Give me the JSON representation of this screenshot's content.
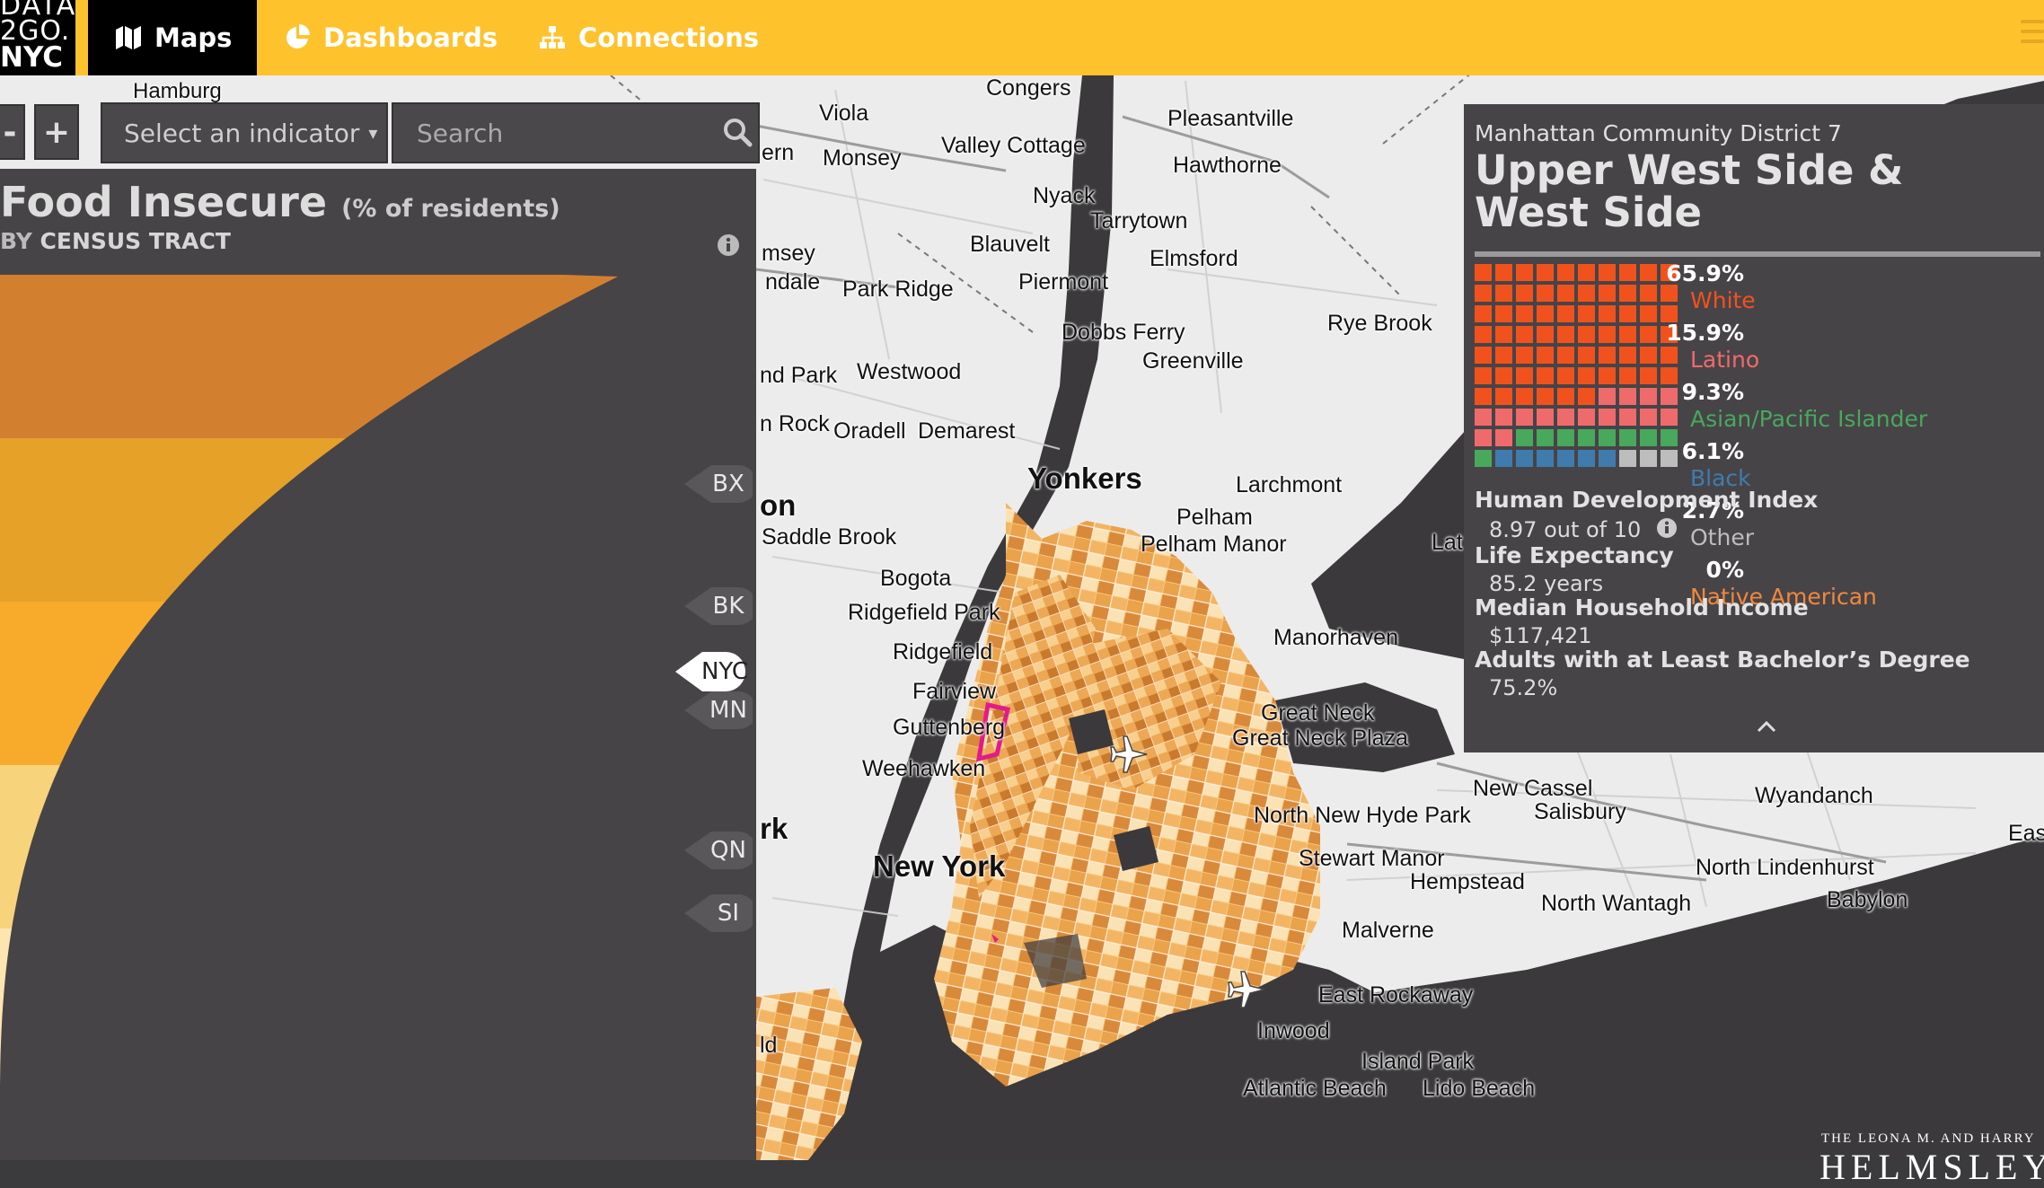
{
  "nav": {
    "logo": {
      "line1": "DATA",
      "line2": "2GO.",
      "line3": "NYC"
    },
    "tabs": [
      {
        "label": "Maps",
        "icon": "map-icon"
      },
      {
        "label": "Dashboards",
        "icon": "pie-chart-icon"
      },
      {
        "label": "Connections",
        "icon": "sitemap-icon"
      }
    ],
    "menu_icon": "hamburger-icon"
  },
  "controls": {
    "zoom_out": "-",
    "zoom_in": "+",
    "indicator_select": "Select an indicator",
    "search_placeholder": "Search"
  },
  "left_panel": {
    "title": "Food Insecure",
    "title_unit": "(% of residents)",
    "subtitle_prefix": "BY",
    "subtitle_strong": "CENSUS TRACT",
    "boroughs": [
      "BX",
      "BK",
      "NYC",
      "MN",
      "QN",
      "SI"
    ],
    "band_colors": [
      "#d28030",
      "#e6a129",
      "#f8ab2a",
      "#f7d37c",
      "#fce5b0"
    ]
  },
  "map_labels": [
    "Hamburg",
    "Congers",
    "Pleasantville",
    "Viola",
    "Monsey",
    "Valley Cottage",
    "Hawthorne",
    "Nyack",
    "Tarrytown",
    "Blauvelt",
    "Elmsford",
    "Park Ridge",
    "Piermont",
    "Dobbs Ferry",
    "Rye Brook",
    "Greenville",
    "Westwood",
    "Oradell",
    "Demarest",
    "Yonkers",
    "Larchmont",
    "Pelham",
    "Pelham Manor",
    "Saddle Brook",
    "Bogota",
    "Ridgefield Park",
    "Ridgefield",
    "Manorhaven",
    "Fairview",
    "Guttenberg",
    "Great Neck",
    "Great Neck Plaza",
    "Weehawken",
    "New Cassel",
    "Salisbury",
    "Wyandanch",
    "North New Hyde Park",
    "Stewart Manor",
    "New York",
    "Hempstead",
    "North Lindenhurst",
    "North Wantagh",
    "Babylon",
    "Malverne",
    "East Rockaway",
    "Inwood",
    "Island Park",
    "Atlantic Beach",
    "Lido Beach",
    "ern",
    "msey",
    "ndale",
    "nd Park",
    "n Rock",
    "on",
    "rk",
    "ld",
    "Lat",
    "Eas"
  ],
  "district": {
    "label": "Manhattan Community District 7",
    "name": "Upper West Side & West Side",
    "demographics": [
      {
        "pct": "65.9%",
        "label": "White",
        "color": "#f1521d"
      },
      {
        "pct": "15.9%",
        "label": "Latino",
        "color": "#ef6b6b"
      },
      {
        "pct": "9.3%",
        "label": "Asian/Pacific Islander",
        "color": "#48a85c"
      },
      {
        "pct": "6.1%",
        "label": "Black",
        "color": "#3f7cad"
      },
      {
        "pct": "2.7%",
        "label": "Other",
        "color": "#bdbdbd"
      },
      {
        "pct": "0%",
        "label": "Native American",
        "color": "#f0883c"
      }
    ],
    "stats": [
      {
        "label": "Human Development Index",
        "value": "8.97 out of 10"
      },
      {
        "label": "Life Expectancy",
        "value": "85.2 years"
      },
      {
        "label": "Median Household Income",
        "value": "$117,421"
      },
      {
        "label": "Adults with at Least Bachelor’s Degree",
        "value": "75.2%"
      }
    ]
  },
  "footer": {
    "brand_small": "THE LEONA M. AND HARRY",
    "brand_big": "HELMSLEY"
  }
}
